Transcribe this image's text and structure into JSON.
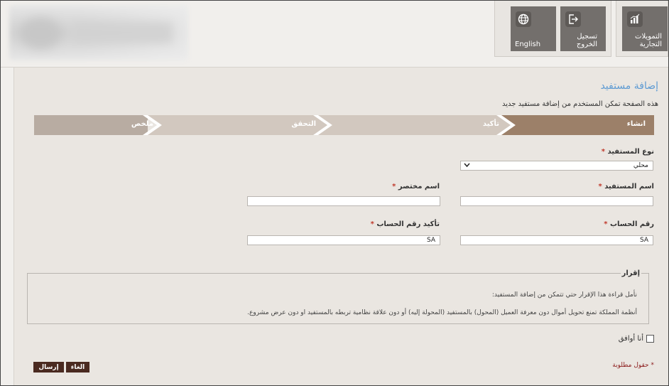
{
  "header": {
    "tiles": {
      "english": "English",
      "logout": "تسجيل الخروج",
      "finance": "التمويلات التجارية"
    }
  },
  "page": {
    "title": "إضافة مستفيد",
    "description": "هذه الصفحة تمكن المستخدم من إضافة مستفيد جديد"
  },
  "steps": [
    "انشاء",
    "تأكيد",
    "التحقق",
    "ملخص"
  ],
  "colors": {
    "active_step": "#9c8069",
    "inactive_step": "#d2c8bf",
    "last_step": "#b8aca2",
    "button": "#4a2a20",
    "title": "#5e9bd3"
  },
  "form": {
    "beneficiary_type": {
      "label": "نوع المستفيد",
      "value": "محلي"
    },
    "beneficiary_name": {
      "label": "اسم المستفيد",
      "value": ""
    },
    "short_name": {
      "label": "اسم مختصر",
      "value": ""
    },
    "account_number": {
      "label": "رقم الحساب",
      "value": "SA"
    },
    "confirm_account": {
      "label": "تأكيد رقم الحساب",
      "value": "SA"
    },
    "required_mark": "*"
  },
  "declaration": {
    "legend": "إقرار",
    "line1": "نأمل قراءة هذا الإقرار حتي تتمكن من إضافة المستفيد:",
    "line2": "أنظمة المملكة تمنع تحويل أموال دون معرفة العميل (المحول) بالمستفيد (المحولة إليه) أو دون علاقة نظامية تربطه بالمستفيد او دون عرض مشروع."
  },
  "agree_label": "أنا أوافق",
  "required_fields_note": "* حقول مطلوبة",
  "buttons": {
    "cancel": "الغاء",
    "submit": "إرسال"
  }
}
